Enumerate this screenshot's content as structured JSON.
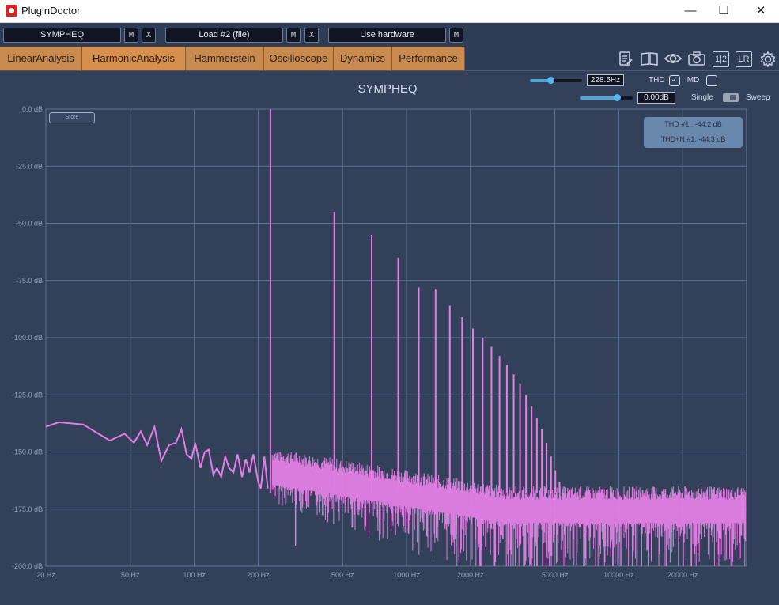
{
  "window": {
    "title": "PluginDoctor",
    "minimize_glyph": "—",
    "maximize_glyph": "☐",
    "close_glyph": "✕"
  },
  "toolbar": {
    "slot1_name": "SYMPHEQ",
    "slot2_name": "Load #2 (file)",
    "slot3_name": "Use hardware",
    "mute_label": "M",
    "remove_label": "X"
  },
  "tabs": [
    {
      "label": "LinearAnalysis"
    },
    {
      "label": "HarmonicAnalysis"
    },
    {
      "label": "Hammerstein"
    },
    {
      "label": "Oscilloscope"
    },
    {
      "label": "Dynamics"
    },
    {
      "label": "Performance"
    }
  ],
  "toolbar_icons": {
    "notes_icon": "notes-icon",
    "manual_icon": "book-icon",
    "view_icon": "eye-icon",
    "snapshot_icon": "camera-icon",
    "half_label": "1|2",
    "lr_label": "LR",
    "settings_icon": "gear-icon"
  },
  "plot": {
    "title": "SYMPHEQ",
    "store_label": "Store",
    "frequency_value": "228.5Hz",
    "frequency_slider_level": 0.4,
    "level_value": "0.00dB",
    "level_slider_level": 0.7,
    "thd_label": "THD",
    "thd_checked": true,
    "imd_label": "IMD",
    "imd_checked": false,
    "single_label": "Single",
    "sweep_label": "Sweep",
    "readout_thd": "THD #1 : -44.2 dB",
    "readout_thdn": "THD+N #1: -44.3 dB"
  },
  "chart_data": {
    "type": "line",
    "title": "SYMPHEQ",
    "xlabel": "",
    "ylabel": "",
    "x_scale": "log",
    "xlim": [
      20,
      40000
    ],
    "ylim": [
      -200,
      0
    ],
    "grid": true,
    "x_ticks": [
      "20 Hz",
      "50 Hz",
      "100 Hz",
      "200 Hz",
      "500 Hz",
      "1000 Hz",
      "2000 Hz",
      "5000 Hz",
      "10000 Hz",
      "20000 Hz"
    ],
    "x_tick_values": [
      20,
      50,
      100,
      200,
      500,
      1000,
      2000,
      5000,
      10000,
      20000
    ],
    "y_ticks": [
      "0.0 dB",
      "-25.0 dB",
      "-50.0 dB",
      "-75.0 dB",
      "-100.0 dB",
      "-125.0 dB",
      "-150.0 dB",
      "-175.0 dB",
      "-200.0 dB"
    ],
    "y_tick_values": [
      0,
      -25,
      -50,
      -75,
      -100,
      -125,
      -150,
      -175,
      -200
    ],
    "series": [
      {
        "color": "#e47ee6",
        "fundamental_hz": 228.5,
        "harmonics": [
          {
            "freq": 228.5,
            "db": 0
          },
          {
            "freq": 457,
            "db": -45
          },
          {
            "freq": 685.5,
            "db": -55
          },
          {
            "freq": 914,
            "db": -65
          },
          {
            "freq": 1142.5,
            "db": -78
          },
          {
            "freq": 1371,
            "db": -79
          },
          {
            "freq": 1599.5,
            "db": -86
          },
          {
            "freq": 1828,
            "db": -91
          },
          {
            "freq": 2056.5,
            "db": -96
          },
          {
            "freq": 2285,
            "db": -100
          },
          {
            "freq": 2513.5,
            "db": -104
          },
          {
            "freq": 2742,
            "db": -108
          },
          {
            "freq": 2970.5,
            "db": -112
          },
          {
            "freq": 3199,
            "db": -116
          },
          {
            "freq": 3427.5,
            "db": -120
          },
          {
            "freq": 3656,
            "db": -125
          },
          {
            "freq": 3884.5,
            "db": -130
          },
          {
            "freq": 4113,
            "db": -135
          },
          {
            "freq": 4341.5,
            "db": -140
          },
          {
            "freq": 4570,
            "db": -146
          },
          {
            "freq": 4798.5,
            "db": -152
          },
          {
            "freq": 5027,
            "db": -158
          },
          {
            "freq": 5255.5,
            "db": -163
          }
        ],
        "low_freq_trace": [
          {
            "freq": 20,
            "db": -139
          },
          {
            "freq": 23,
            "db": -137
          },
          {
            "freq": 30,
            "db": -138
          },
          {
            "freq": 40,
            "db": -145
          },
          {
            "freq": 47,
            "db": -142
          },
          {
            "freq": 52,
            "db": -146
          },
          {
            "freq": 56,
            "db": -141
          },
          {
            "freq": 60,
            "db": -147
          },
          {
            "freq": 65,
            "db": -139
          },
          {
            "freq": 70,
            "db": -154
          },
          {
            "freq": 76,
            "db": -147
          },
          {
            "freq": 82,
            "db": -146
          },
          {
            "freq": 87,
            "db": -140
          },
          {
            "freq": 92,
            "db": -151
          },
          {
            "freq": 97,
            "db": -153
          },
          {
            "freq": 101,
            "db": -146
          },
          {
            "freq": 107,
            "db": -157
          },
          {
            "freq": 112,
            "db": -150
          },
          {
            "freq": 117,
            "db": -149
          },
          {
            "freq": 123,
            "db": -160
          },
          {
            "freq": 128,
            "db": -157
          },
          {
            "freq": 134,
            "db": -161
          },
          {
            "freq": 140,
            "db": -152
          },
          {
            "freq": 146,
            "db": -157
          },
          {
            "freq": 153,
            "db": -159
          },
          {
            "freq": 160,
            "db": -151
          },
          {
            "freq": 168,
            "db": -161
          },
          {
            "freq": 175,
            "db": -153
          },
          {
            "freq": 182,
            "db": -159
          },
          {
            "freq": 190,
            "db": -151
          },
          {
            "freq": 200,
            "db": -163
          },
          {
            "freq": 206,
            "db": -166
          },
          {
            "freq": 214,
            "db": -152
          },
          {
            "freq": 222,
            "db": -166
          }
        ],
        "noise_floor_db": -177
      }
    ]
  }
}
